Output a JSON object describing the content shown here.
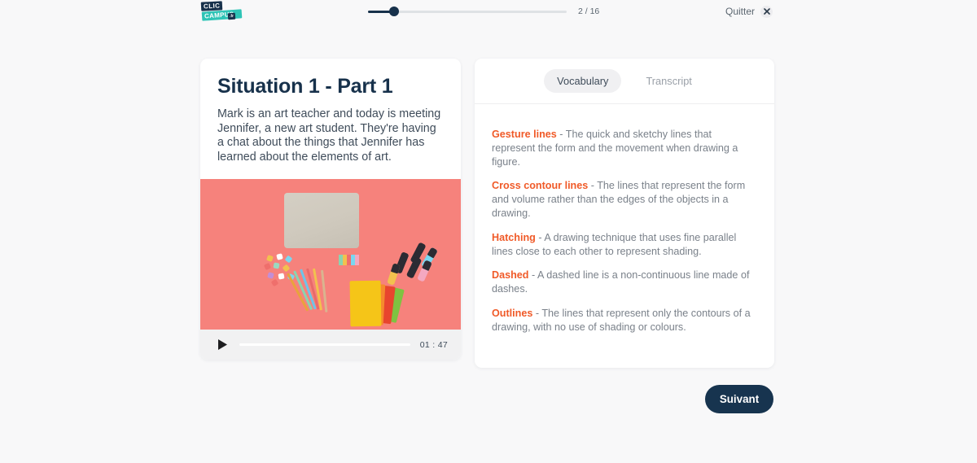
{
  "header": {
    "logo": {
      "part1": "CLIC",
      "part2": "CAMPUS",
      "tld": ".fr"
    },
    "progress": {
      "current": 2,
      "total": 16,
      "label": "2 / 16",
      "percent": 13
    },
    "quit_label": "Quitter",
    "quit_icon": "close-icon"
  },
  "lesson": {
    "title": "Situation 1 - Part 1",
    "description": "Mark is an art teacher and today is meeting Jennifer, a new art student. They're having a chat about the things that Jennifer has learned about the elements of art.",
    "media": {
      "type": "image",
      "alt": "Flat lay of a laptop, coloured pencils, notebooks, markers and push pins on a coral background",
      "background_color": "#f6827c"
    },
    "player": {
      "play_icon": "play-icon",
      "duration": "01 : 47",
      "progress_percent": 0
    }
  },
  "panel": {
    "tabs": [
      {
        "label": "Vocabulary",
        "active": true
      },
      {
        "label": "Transcript",
        "active": false
      }
    ],
    "vocabulary": [
      {
        "term": "Gesture lines",
        "definition": " - The quick and sketchy lines that represent the form and the movement when drawing a figure."
      },
      {
        "term": "Cross contour lines",
        "definition": " - The lines that represent the form and volume rather than the edges of the objects in a drawing."
      },
      {
        "term": "Hatching",
        "definition": " - A drawing technique that uses fine parallel lines close to each other to represent shading."
      },
      {
        "term": "Dashed",
        "definition": " - A dashed line is a non-continuous line made of dashes."
      },
      {
        "term": "Outlines",
        "definition": " - The lines that represent only the contours of a drawing, with no use of shading or colours."
      }
    ]
  },
  "footer": {
    "next_label": "Suivant"
  },
  "colors": {
    "page_background": "#f8f8f9",
    "navy": "#17314b",
    "teal": "#2ec4b6",
    "orange": "#f05a28",
    "coral": "#f6827c",
    "muted_text": "#7a818a"
  }
}
